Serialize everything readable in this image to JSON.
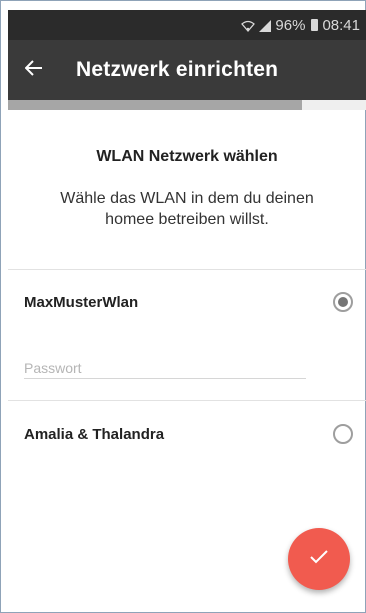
{
  "status_bar": {
    "battery": "96%",
    "time": "08:41"
  },
  "app_bar": {
    "title": "Netzwerk einrichten",
    "back_icon": "arrow-left-icon"
  },
  "progress": {
    "fraction": 0.82
  },
  "main": {
    "heading": "WLAN Netzwerk wählen",
    "description": "Wähle das WLAN in dem du deinen homee betreiben willst."
  },
  "networks": [
    {
      "name": "MaxMusterWlan",
      "selected": true
    },
    {
      "name": "Amalia & Thalandra",
      "selected": false
    }
  ],
  "password": {
    "placeholder": "Passwort",
    "value": ""
  },
  "fab": {
    "icon": "check-icon",
    "color": "#f15b4f"
  }
}
